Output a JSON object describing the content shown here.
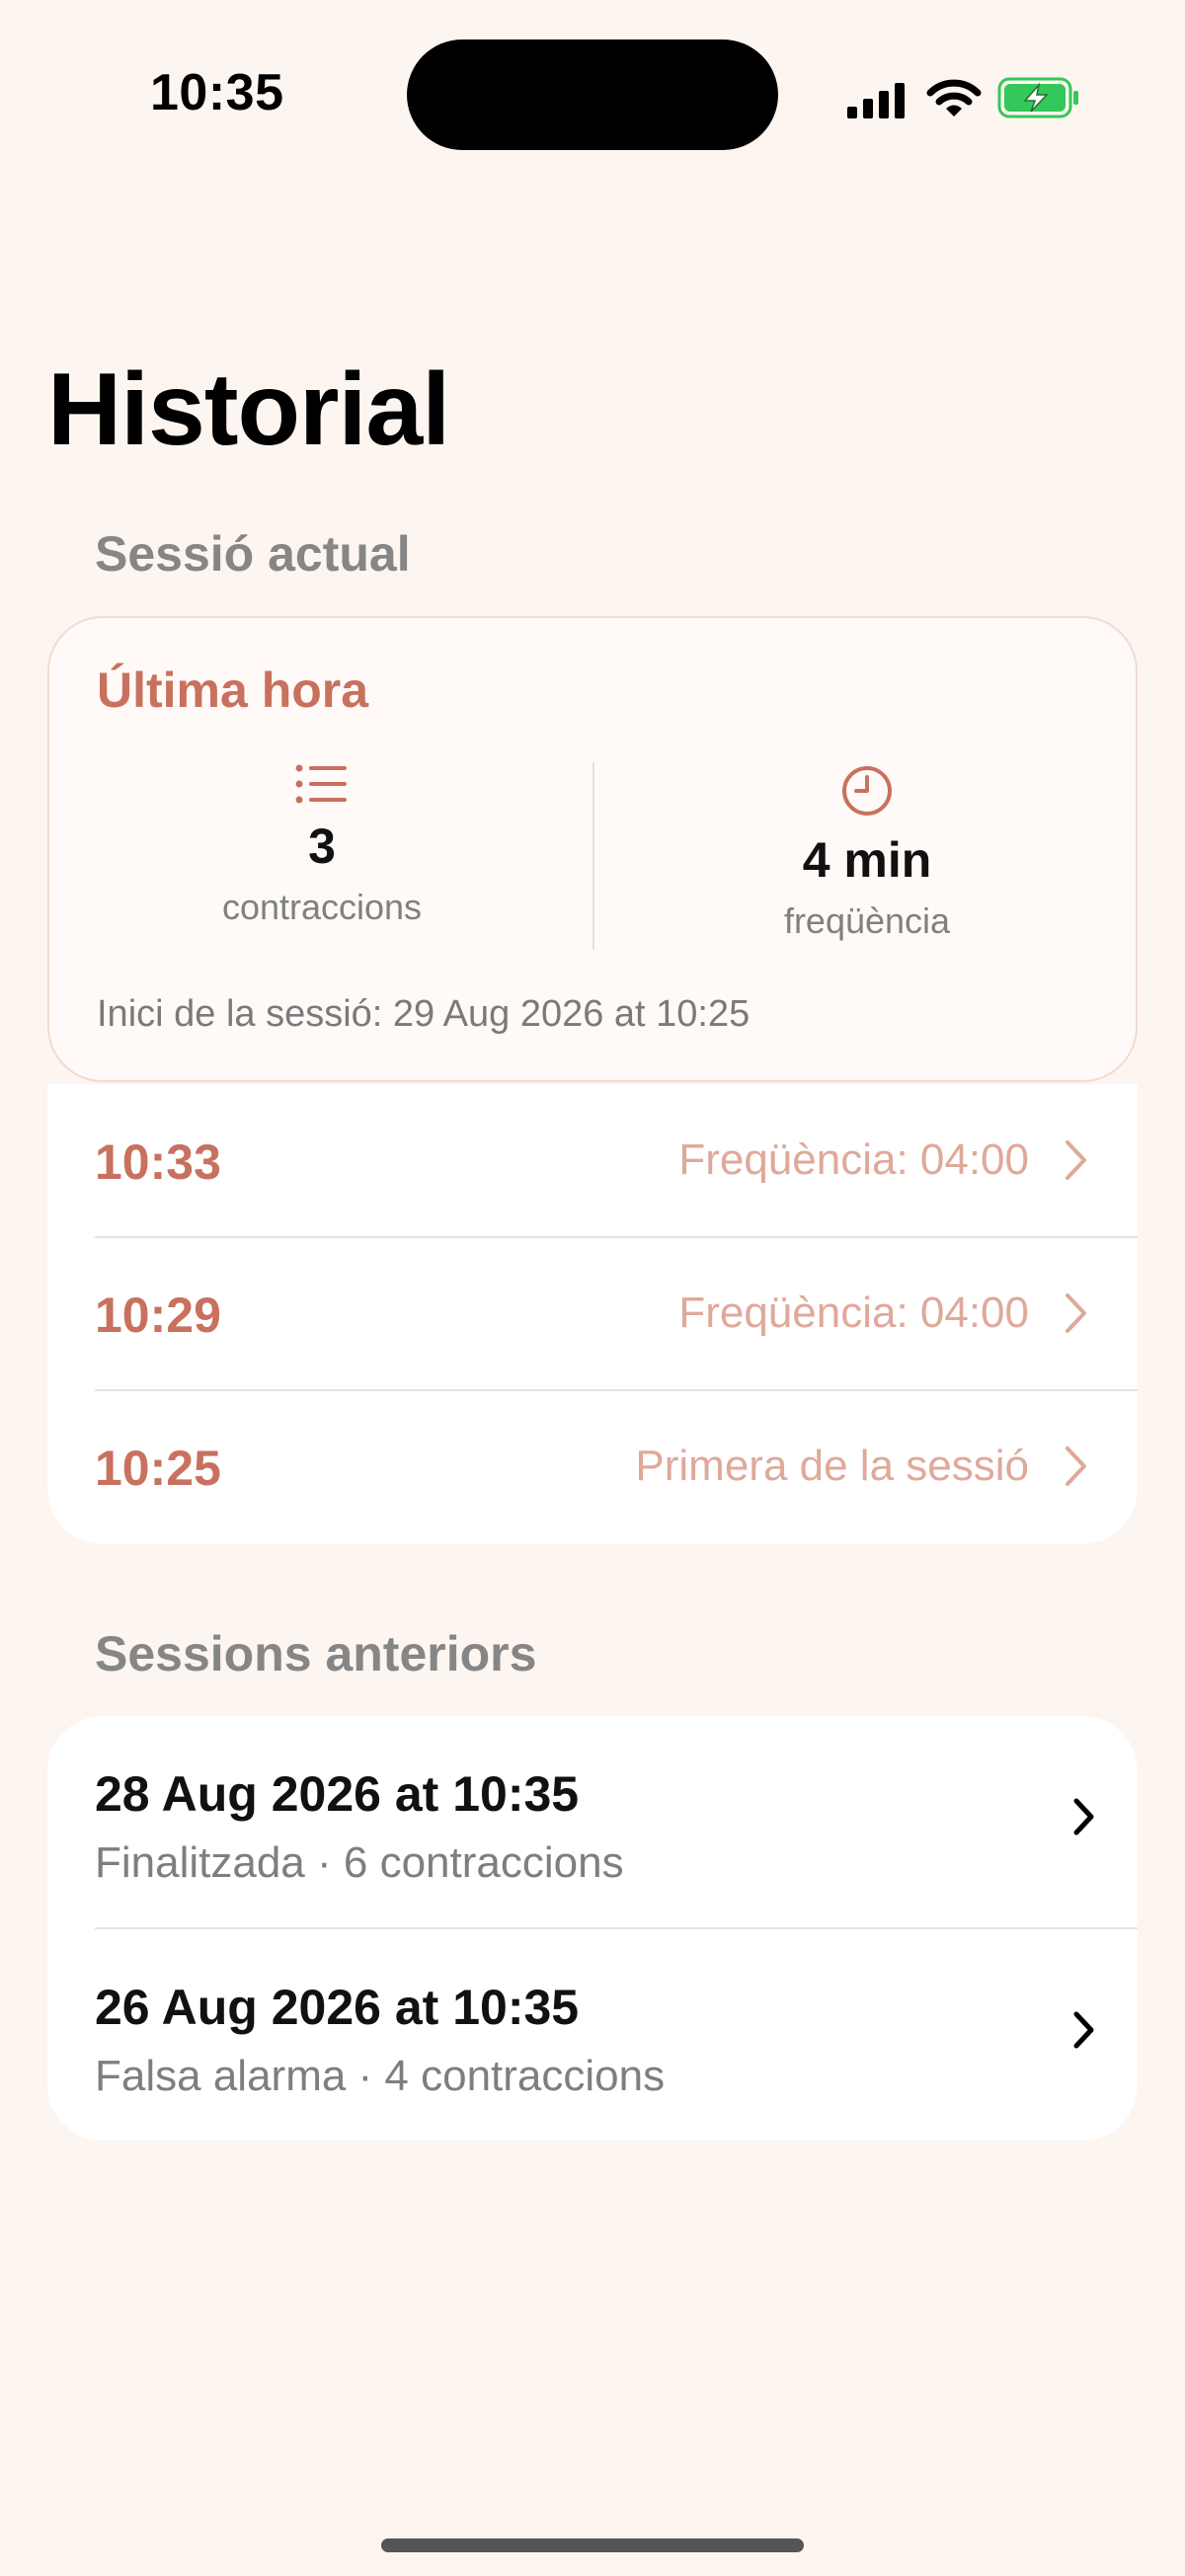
{
  "status_bar": {
    "time": "10:35",
    "icons": [
      "cellular-signal-icon",
      "wifi-icon",
      "battery-charging-icon"
    ],
    "battery_color": "#34C759"
  },
  "page": {
    "title": "Historial"
  },
  "current_session": {
    "section_label": "Sessió actual",
    "summary": {
      "title": "Última hora",
      "stats": [
        {
          "icon": "list-icon",
          "value": "3",
          "label": "contraccions"
        },
        {
          "icon": "clock-icon",
          "value": "4 min",
          "label": "freqüència"
        }
      ],
      "session_start": "Inici de la sessió: 29 Aug 2026 at 10:25"
    },
    "contractions": [
      {
        "time": "10:33",
        "detail": "Freqüència: 04:00"
      },
      {
        "time": "10:29",
        "detail": "Freqüència: 04:00"
      },
      {
        "time": "10:25",
        "detail": "Primera de la sessió"
      }
    ]
  },
  "previous_sessions": {
    "section_label": "Sessions anteriors",
    "items": [
      {
        "title": "28 Aug 2026 at 10:35",
        "subtitle": "Finalitzada · 6 contraccions"
      },
      {
        "title": "26 Aug 2026 at 10:35",
        "subtitle": "Falsa alarma · 4 contraccions"
      }
    ]
  },
  "colors": {
    "accent": "#C8715E",
    "accent_light": "#DFA99A",
    "background": "#FDF5F0"
  }
}
